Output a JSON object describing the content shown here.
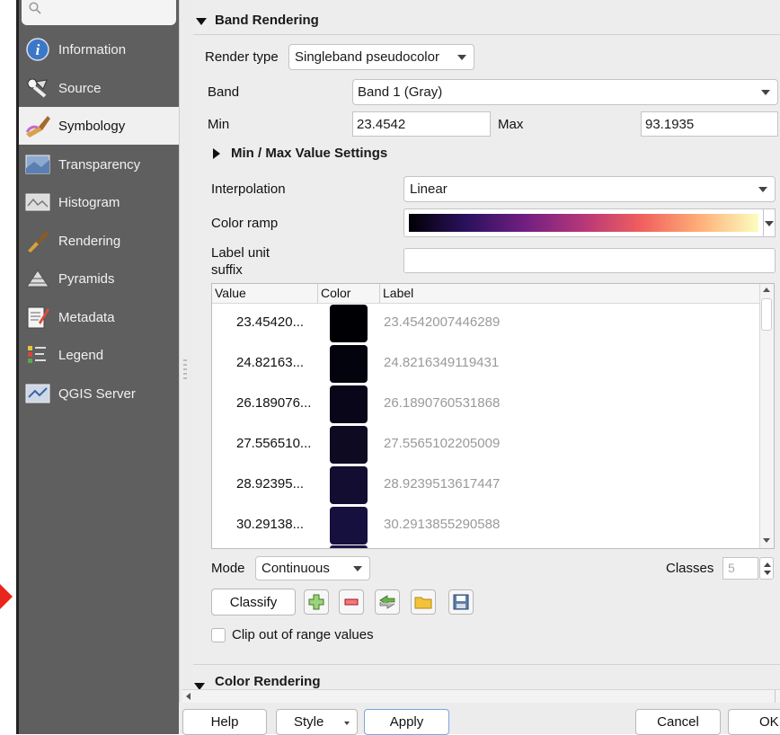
{
  "sidebar": {
    "search_icon": "search-icon",
    "items": [
      {
        "label": "Information",
        "icon": "information-icon",
        "selected": false
      },
      {
        "label": "Source",
        "icon": "source-icon",
        "selected": false
      },
      {
        "label": "Symbology",
        "icon": "symbology-icon",
        "selected": true
      },
      {
        "label": "Transparency",
        "icon": "transparency-icon",
        "selected": false
      },
      {
        "label": "Histogram",
        "icon": "histogram-icon",
        "selected": false
      },
      {
        "label": "Rendering",
        "icon": "rendering-icon",
        "selected": false
      },
      {
        "label": "Pyramids",
        "icon": "pyramids-icon",
        "selected": false
      },
      {
        "label": "Metadata",
        "icon": "metadata-icon",
        "selected": false
      },
      {
        "label": "Legend",
        "icon": "legend-icon",
        "selected": false
      },
      {
        "label": "QGIS Server",
        "icon": "qgis-server-icon",
        "selected": false
      }
    ]
  },
  "band_rendering": {
    "title": "Band Rendering",
    "render_type_label": "Render type",
    "render_type_value": "Singleband pseudocolor",
    "band_label": "Band",
    "band_value": "Band 1 (Gray)",
    "min_label": "Min",
    "min_value": "23.4542",
    "max_label": "Max",
    "max_value": "93.1935",
    "minmax_settings_label": "Min / Max Value Settings",
    "interpolation_label": "Interpolation",
    "interpolation_value": "Linear",
    "color_ramp_label": "Color ramp",
    "color_ramp_colors": [
      "#000004",
      "#2c115f",
      "#721f81",
      "#b73779",
      "#f1605d",
      "#feb078",
      "#fcfdbf"
    ],
    "label_unit_suffix_label_line1": "Label unit",
    "label_unit_suffix_label_line2": "suffix",
    "label_unit_suffix_value": ""
  },
  "table": {
    "headers": [
      "Value",
      "Color",
      "Label"
    ],
    "rows": [
      {
        "value": "23.45420...",
        "color": "#000004",
        "label": "23.4542007446289"
      },
      {
        "value": "24.82163...",
        "color": "#03030e",
        "label": "24.8216349119431"
      },
      {
        "value": "26.189076...",
        "color": "#080618",
        "label": "26.1890760531868"
      },
      {
        "value": "27.556510...",
        "color": "#0d0a22",
        "label": "27.5565102205009"
      },
      {
        "value": "28.92395...",
        "color": "#120d31",
        "label": "28.9239513617447"
      },
      {
        "value": "30.29138...",
        "color": "#16103e",
        "label": "30.2913855290588"
      }
    ]
  },
  "mode": {
    "label": "Mode",
    "value": "Continuous",
    "classes_label": "Classes",
    "classes_value": "5"
  },
  "toolbar": {
    "classify_label": "Classify",
    "tools": [
      "add-class-icon",
      "remove-class-icon",
      "reverse-colors-icon",
      "load-folder-icon",
      "save-icon"
    ]
  },
  "clip_label": "Clip out of range values",
  "clip_checked": false,
  "color_rendering": {
    "title": "Color Rendering"
  },
  "footer": {
    "help_label": "Help",
    "style_label": "Style",
    "apply_label": "Apply",
    "cancel_label": "Cancel",
    "ok_label": "OK"
  }
}
